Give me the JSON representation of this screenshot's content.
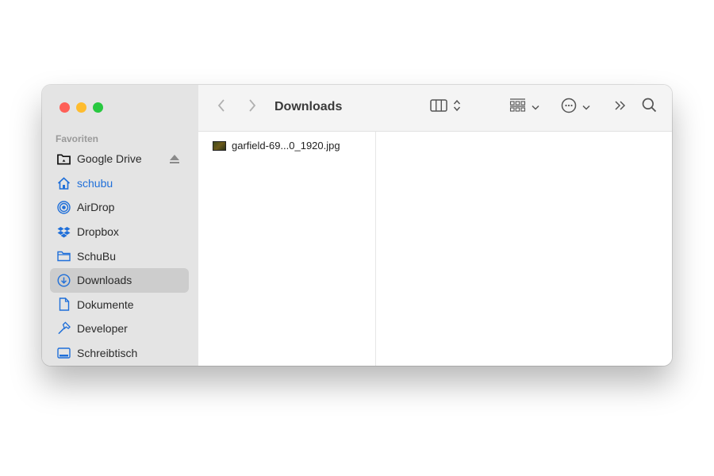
{
  "window": {
    "title": "Downloads"
  },
  "sidebar": {
    "section": "Favoriten",
    "items": [
      {
        "label": "Google Drive",
        "icon": "drive-folder-icon"
      },
      {
        "label": "schubu",
        "icon": "home-icon"
      },
      {
        "label": "AirDrop",
        "icon": "airdrop-icon"
      },
      {
        "label": "Dropbox",
        "icon": "dropbox-icon"
      },
      {
        "label": "SchuBu",
        "icon": "folder-icon"
      },
      {
        "label": "Downloads",
        "icon": "download-icon"
      },
      {
        "label": "Dokumente",
        "icon": "document-icon"
      },
      {
        "label": "Developer",
        "icon": "hammer-icon"
      },
      {
        "label": "Schreibtisch",
        "icon": "desktop-icon"
      }
    ]
  },
  "files": [
    {
      "name": "garfield-69...0_1920.jpg"
    }
  ],
  "colors": {
    "accent": "#1f6fd9",
    "sidebar": "#e4e4e4"
  }
}
